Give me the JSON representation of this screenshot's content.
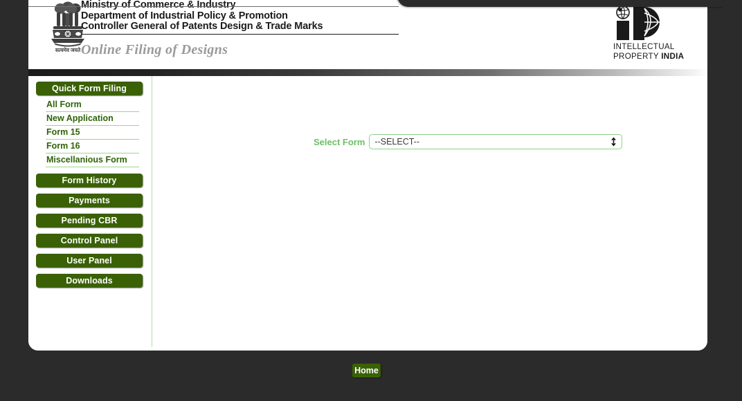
{
  "header": {
    "emblem_icon": "india-state-emblem-icon",
    "emblem_motto": "सत्यमेव जयते",
    "line1": "Ministry of Commerce & Industry",
    "line2": "Department of Industrial Policy & Promotion",
    "line3": "Controller General of Patents Design & Trade Marks",
    "subtitle": "Online Filing of Designs",
    "logo": {
      "icon": "intellectual-property-india-logo-icon",
      "text_line1": "INTELLECTUAL",
      "text_line2_light": "PROPERTY ",
      "text_line2_bold": "INDIA"
    }
  },
  "sidebar": {
    "quick_form_filing": "Quick Form Filing",
    "sublinks": [
      {
        "label": "All Form"
      },
      {
        "label": "New Application"
      },
      {
        "label": "Form 15"
      },
      {
        "label": "Form 16"
      },
      {
        "label": "Miscellanious Form"
      }
    ],
    "buttons": [
      {
        "label": "Form History"
      },
      {
        "label": "Payments"
      },
      {
        "label": "Pending CBR"
      },
      {
        "label": "Control Panel"
      },
      {
        "label": "User Panel"
      },
      {
        "label": "Downloads"
      }
    ]
  },
  "main": {
    "select_form_label": "Select Form",
    "select_form_value": "--SELECT--",
    "select_form_options": [
      "--SELECT--"
    ],
    "stepper_icon": "up-down-stepper-icon"
  },
  "footer": {
    "home_label": "Home"
  },
  "colors": {
    "nav_green": "#3a6105",
    "link_green": "#2f6308",
    "label_green": "#6cbf67",
    "border_green": "#8fd18a",
    "stage_dark": "#2b2b2b"
  }
}
